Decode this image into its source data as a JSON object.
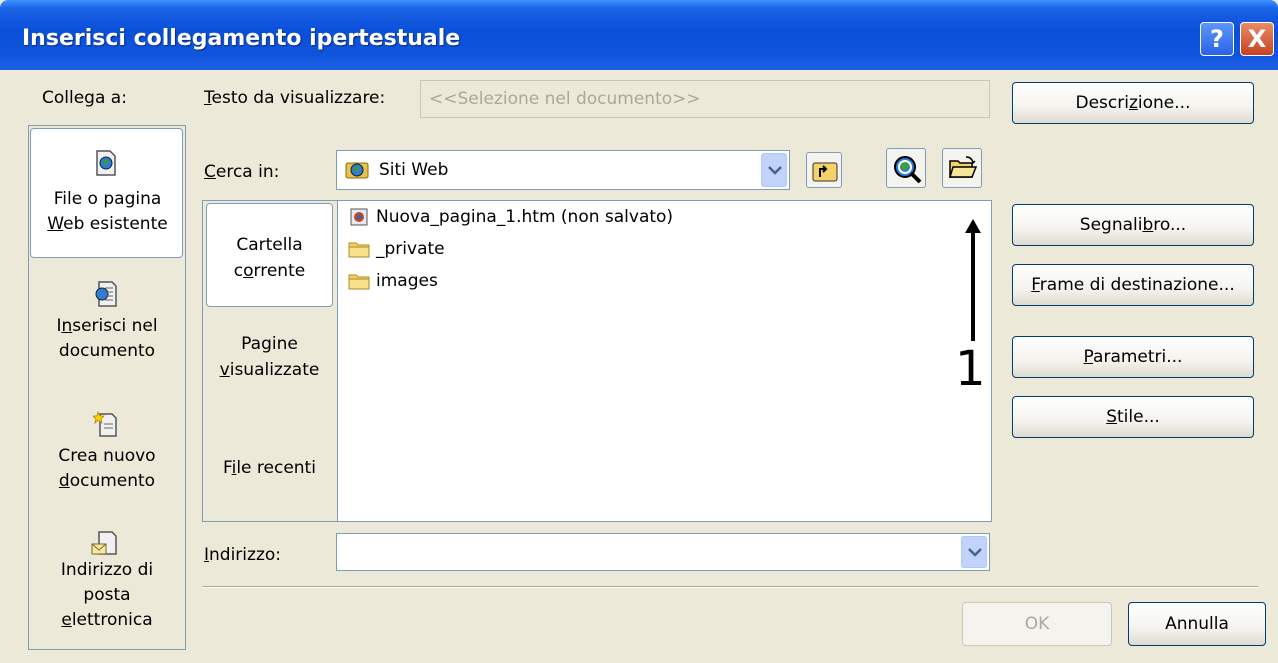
{
  "window": {
    "title": "Inserisci collegamento ipertestuale",
    "help_glyph": "?",
    "close_glyph": "X"
  },
  "link_to": {
    "label": "Collega a:",
    "items": [
      {
        "line1": "File o pagina",
        "line2": "Web esistente",
        "icon": "web-page-icon",
        "selected": true
      },
      {
        "line1": "Inserisci nel",
        "line2": "documento",
        "icon": "place-in-document-icon",
        "selected": false
      },
      {
        "line1": "Crea nuovo",
        "line2": "documento",
        "icon": "new-document-icon",
        "selected": false
      },
      {
        "line1": "Indirizzo di",
        "line2": "posta",
        "line3": "elettronica",
        "icon": "email-address-icon",
        "selected": false
      }
    ]
  },
  "text_to_display": {
    "label": "Testo da visualizzare:",
    "placeholder": "<<Selezione nel documento>>"
  },
  "buttons": {
    "screentip": "Descrizione...",
    "bookmark": "Segnalibro...",
    "target_frame": "Frame di destinazione...",
    "parameters": "Parametri...",
    "style": "Stile...",
    "ok": "OK",
    "cancel": "Annulla"
  },
  "look_in": {
    "label": "Cerca in:",
    "value": "Siti Web"
  },
  "nav_tabs": [
    {
      "line1": "Cartella",
      "line2": "corrente",
      "selected": true
    },
    {
      "line1": "Pagine",
      "line2": "visualizzate",
      "selected": false
    },
    {
      "line1": "File recenti",
      "line2": "",
      "selected": false
    }
  ],
  "files": [
    {
      "name": "Nuova_pagina_1.htm (non salvato)",
      "icon": "html-page-icon"
    },
    {
      "name": "_private",
      "icon": "folder-icon"
    },
    {
      "name": "images",
      "icon": "folder-icon"
    }
  ],
  "annotation": {
    "number": "1"
  },
  "address": {
    "label": "Indirizzo:",
    "value": ""
  }
}
